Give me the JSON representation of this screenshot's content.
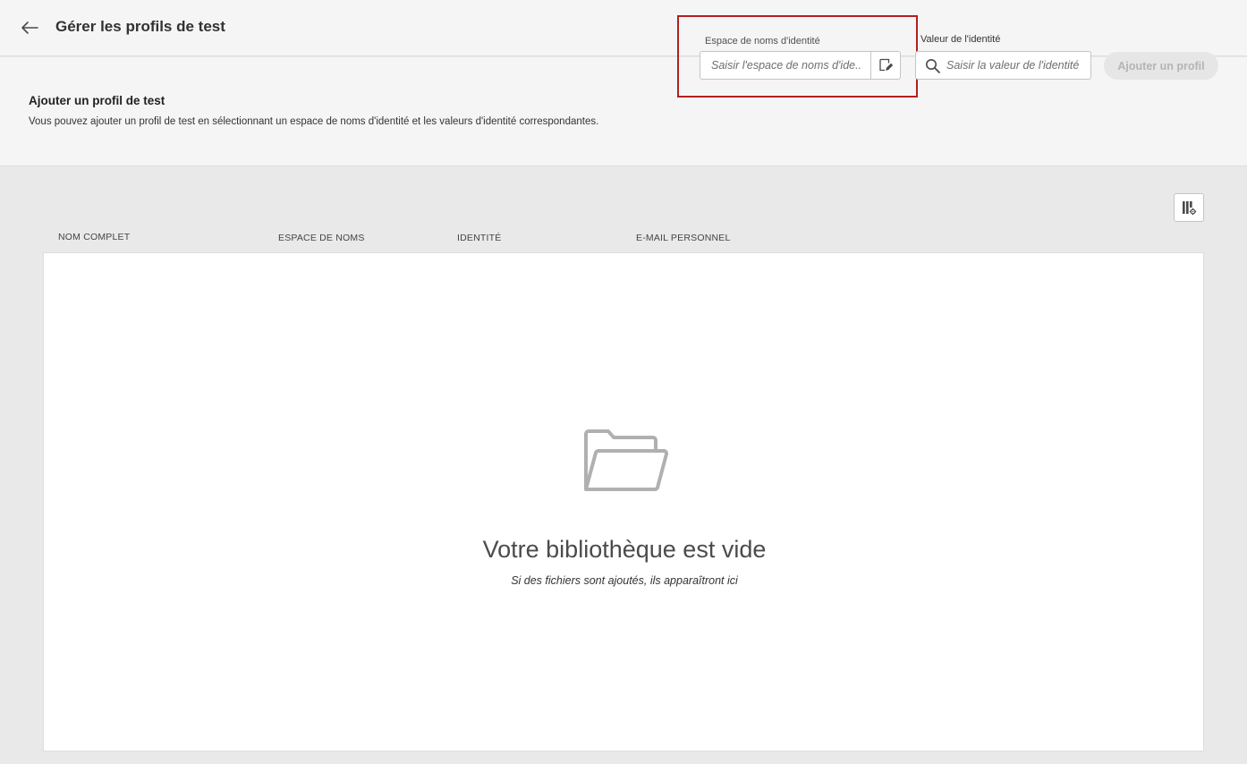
{
  "header": {
    "title": "Gérer les profils de test",
    "back_icon": "arrow-left-icon"
  },
  "add_profile": {
    "title": "Ajouter un profil de test",
    "description": "Vous pouvez ajouter un profil de test en sélectionnant un espace de noms d'identité et les valeurs d'identité correspondantes.",
    "namespace": {
      "label": "Espace de noms d'identité",
      "placeholder": "Saisir l'espace de noms d'ide...",
      "value": "",
      "picker_icon": "edit-select-icon"
    },
    "identity_value": {
      "label": "Valeur de l'identité",
      "placeholder": "Saisir la valeur de l'identité",
      "value": "",
      "icon": "search-icon"
    },
    "add_button": "Ajouter un profil",
    "add_button_disabled": true
  },
  "table": {
    "settings_icon": "column-settings-icon",
    "columns": [
      "NOM COMPLET",
      "ESPACE DE NOMS",
      "IDENTITÉ",
      "E-MAIL PERSONNEL"
    ],
    "rows": [],
    "empty_state": {
      "icon": "folder-open-icon",
      "title": "Votre bibliothèque est vide",
      "subtitle": "Si des fichiers sont ajoutés, ils apparaîtront ici"
    }
  },
  "colors": {
    "highlight": "#b32020",
    "panel_bg": "#f5f5f5",
    "canvas_bg": "#e9e9e9"
  }
}
